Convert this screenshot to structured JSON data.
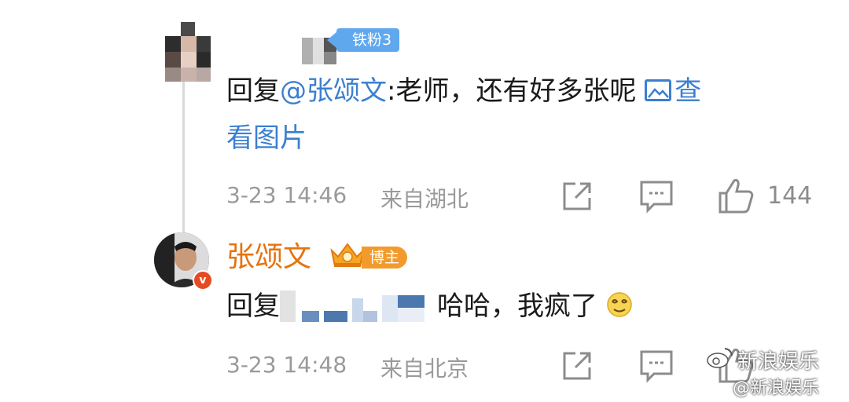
{
  "comment1": {
    "fan_badge": "铁粉3",
    "reply_prefix": "回复",
    "mention": "@张颂文",
    "reply_body": ":老师，还有好多张呢",
    "image_link_part1": "查",
    "image_link_part2": "看图片",
    "timestamp": "3-23 14:46",
    "location": "来自湖北",
    "like_count": "144"
  },
  "comment2": {
    "user_name": "张颂文",
    "blogger_badge": "博主",
    "verified_mark": "v",
    "reply_prefix": "回复",
    "reply_suffix": "哈哈，我疯了",
    "timestamp": "3-23 14:48",
    "location": "来自北京"
  },
  "watermark": {
    "text": "新浪娱乐",
    "handle": "@新浪娱乐"
  },
  "icons": {
    "share": "share-icon",
    "comment": "comment-icon",
    "like": "thumbs-up-icon"
  },
  "colors": {
    "link_blue": "#3b7fd0",
    "name_orange": "#e8720e",
    "fan_badge_blue": "#5fa8ee",
    "blogger_badge_orange": "#f29b2c",
    "meta_gray": "#9a9a9a"
  }
}
